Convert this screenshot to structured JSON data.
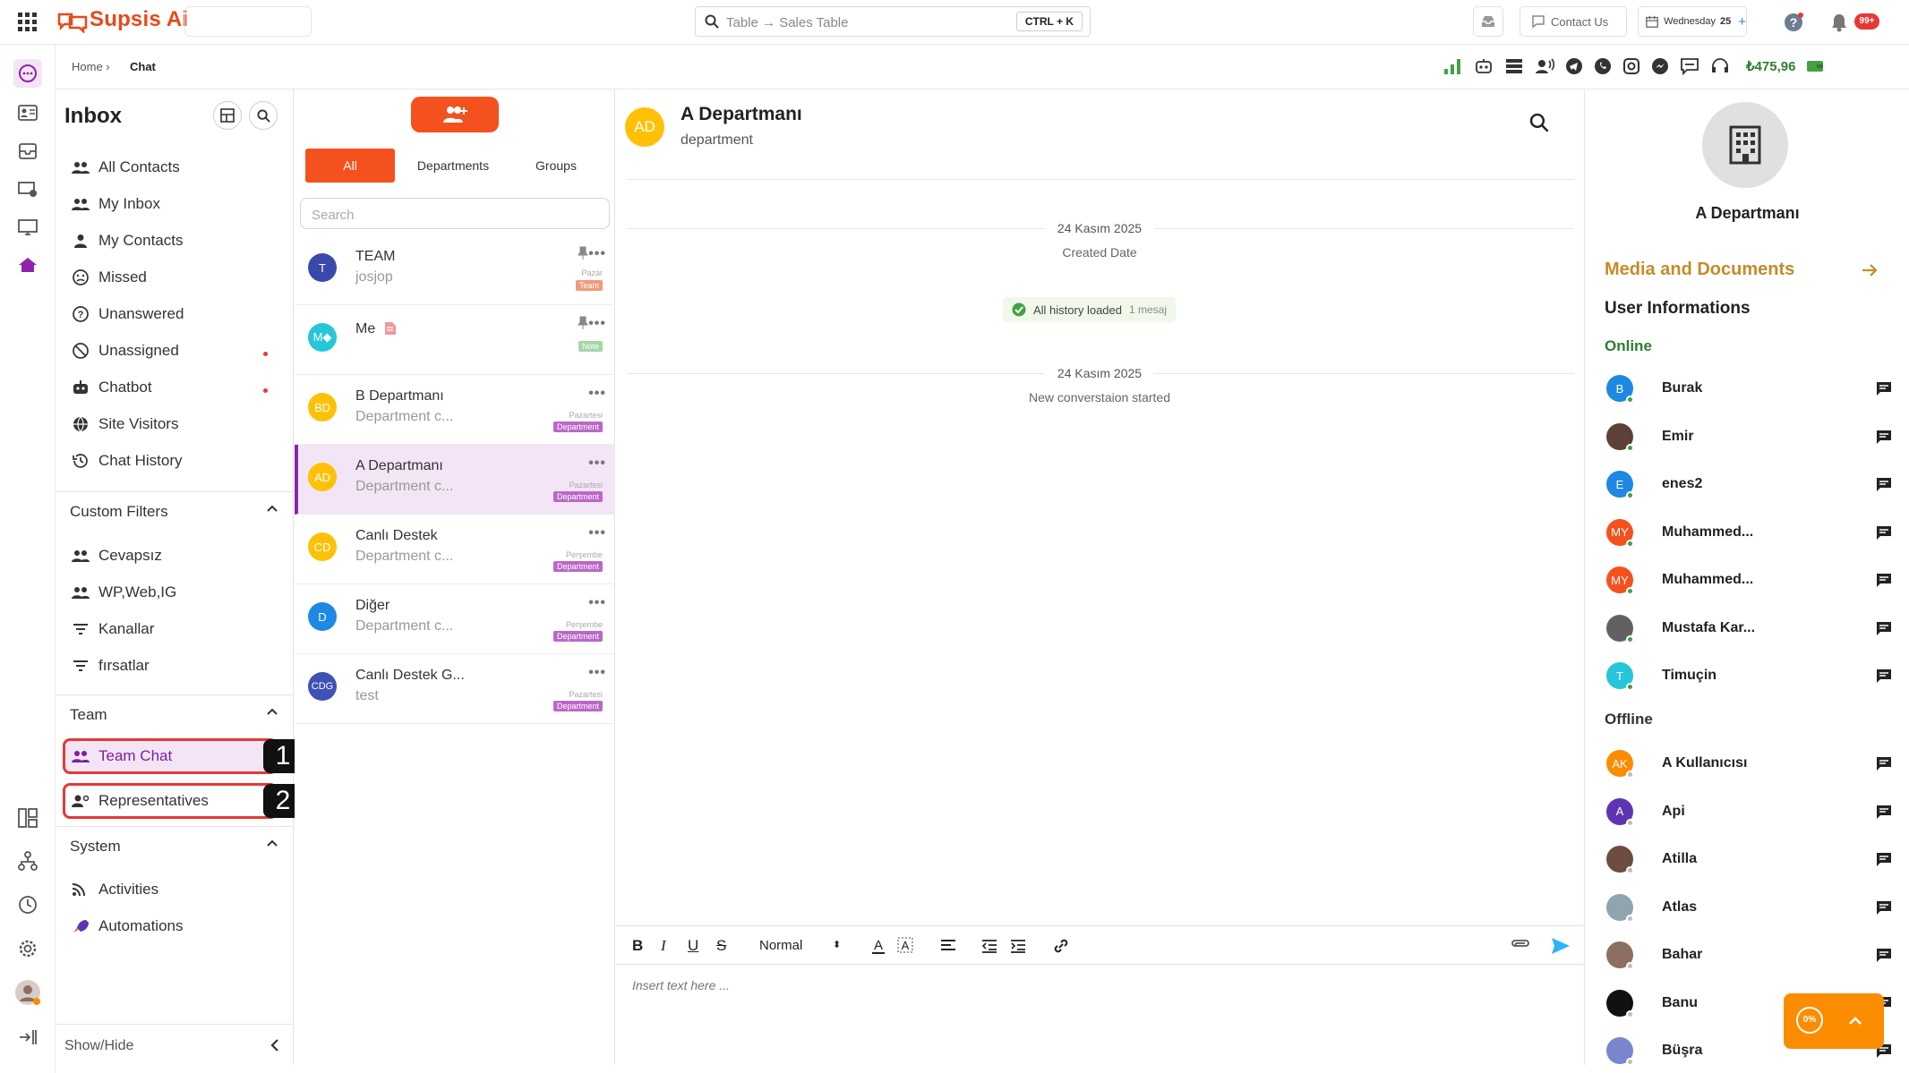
{
  "app": {
    "brand": "Supsis Ai"
  },
  "topbar": {
    "search_placeholder": "Table → Sales Table",
    "shortcut": "CTRL + K",
    "contact_us": "Contact Us",
    "date_day": "Wednesday",
    "date_num": "25",
    "notif_badge": "99+"
  },
  "breadcrumb": {
    "home": "Home ›",
    "current": "Chat"
  },
  "status": {
    "balance": "₺475,96"
  },
  "inbox": {
    "title": "Inbox",
    "items": [
      {
        "label": "All Contacts",
        "icon": "users-icon"
      },
      {
        "label": "My Inbox",
        "icon": "users-icon"
      },
      {
        "label": "My Contacts",
        "icon": "user-icon"
      },
      {
        "label": "Missed",
        "icon": "sad-face-icon"
      },
      {
        "label": "Unanswered",
        "icon": "question-icon"
      },
      {
        "label": "Unassigned",
        "icon": "unassigned-icon"
      },
      {
        "label": "Chatbot",
        "icon": "robot-icon"
      },
      {
        "label": "Site Visitors",
        "icon": "globe-icon"
      },
      {
        "label": "Chat History",
        "icon": "history-icon"
      }
    ],
    "custom_filters": {
      "title": "Custom Filters",
      "items": [
        {
          "label": "Cevapsız"
        },
        {
          "label": "WP,Web,IG"
        },
        {
          "label": "Kanallar"
        },
        {
          "label": "fırsatlar"
        }
      ]
    },
    "team": {
      "title": "Team",
      "items": [
        {
          "label": "Team Chat",
          "marker": "1"
        },
        {
          "label": "Representatives",
          "marker": "2"
        }
      ]
    },
    "system": {
      "title": "System",
      "items": [
        {
          "label": "Activities"
        },
        {
          "label": "Automations"
        }
      ]
    },
    "footer": "Show/Hide"
  },
  "convlist": {
    "tabs": [
      "All",
      "Departments",
      "Groups"
    ],
    "search_placeholder": "Search",
    "items": [
      {
        "avatar": "T",
        "color": "#3949ab",
        "name": "TEAM",
        "preview": "josjop",
        "date": "Pazar",
        "tag": "Team",
        "tag_color": "#ef9a7a",
        "pinned": true
      },
      {
        "avatar": "M◆",
        "color": "#26c6da",
        "name": "Me",
        "preview": "",
        "date": "",
        "tag": "Note",
        "tag_color": "#a5d6a7",
        "pinned": true
      },
      {
        "avatar": "BD",
        "color": "#ffc107",
        "name": "B Departmanı",
        "preview": "Department c...",
        "date": "Pazartesi",
        "tag": "Department",
        "tag_color": "#ba68c8",
        "pinned": false
      },
      {
        "avatar": "AD",
        "color": "#ffc107",
        "name": "A Departmanı",
        "preview": "Department c...",
        "date": "Pazartesi",
        "tag": "Department",
        "tag_color": "#ba68c8",
        "pinned": false
      },
      {
        "avatar": "CD",
        "color": "#ffc107",
        "name": "Canlı Destek",
        "preview": "Department c...",
        "date": "Perşembe",
        "tag": "Department",
        "tag_color": "#ba68c8",
        "pinned": false
      },
      {
        "avatar": "D",
        "color": "#1e88e5",
        "name": "Diğer",
        "preview": "Department c...",
        "date": "Perşembe",
        "tag": "Department",
        "tag_color": "#ba68c8",
        "pinned": false
      },
      {
        "avatar": "CDG",
        "color": "#3f51b5",
        "name": "Canlı Destek G...",
        "preview": "test",
        "date": "Pazartesi",
        "tag": "Department",
        "tag_color": "#ba68c8",
        "pinned": false
      }
    ]
  },
  "chat": {
    "avatar": "AD",
    "title": "A Departmanı",
    "subtitle": "department",
    "events": [
      {
        "date": "24 Kasım 2025",
        "label": "Created Date"
      },
      {
        "date": "24 Kasım 2025",
        "label": "New converstaion started"
      }
    ],
    "history": "All history loaded",
    "history_count": "1 mesaj",
    "editor": {
      "format": "Normal",
      "placeholder": "Insert text here ..."
    }
  },
  "right": {
    "name": "A Departmanı",
    "media": "Media and Documents",
    "user_info": "User Informations",
    "online_label": "Online",
    "offline_label": "Offline",
    "online": [
      {
        "initials": "B",
        "name": "Burak",
        "color": "#1e88e5"
      },
      {
        "initials": "",
        "name": "Emir",
        "color": "#5d4037"
      },
      {
        "initials": "E",
        "name": "enes2",
        "color": "#1e88e5"
      },
      {
        "initials": "MY",
        "name": "Muhammed...",
        "color": "#f4511e"
      },
      {
        "initials": "MY",
        "name": "Muhammed...",
        "color": "#f4511e"
      },
      {
        "initials": "",
        "name": "Mustafa Kar...",
        "color": "#616161"
      },
      {
        "initials": "T",
        "name": "Timuçin",
        "color": "#26c6da"
      }
    ],
    "offline": [
      {
        "initials": "AK",
        "name": "A Kullanıcısı",
        "color": "#fb8c00"
      },
      {
        "initials": "A",
        "name": "Api",
        "color": "#5e35b1"
      },
      {
        "initials": "",
        "name": "Atilla",
        "color": "#6d4c41"
      },
      {
        "initials": "",
        "name": "Atlas",
        "color": "#90a4ae"
      },
      {
        "initials": "",
        "name": "Bahar",
        "color": "#8d6e63"
      },
      {
        "initials": "",
        "name": "Banu",
        "color": "#111111"
      },
      {
        "initials": "",
        "name": "Büşra",
        "color": "#7986cb"
      }
    ]
  },
  "fab": {
    "percent": "0%"
  },
  "colors": {
    "accent": "#f4511e",
    "purple": "#8e24aa",
    "online": "#2e7d32",
    "gold": "#c58b2a"
  }
}
